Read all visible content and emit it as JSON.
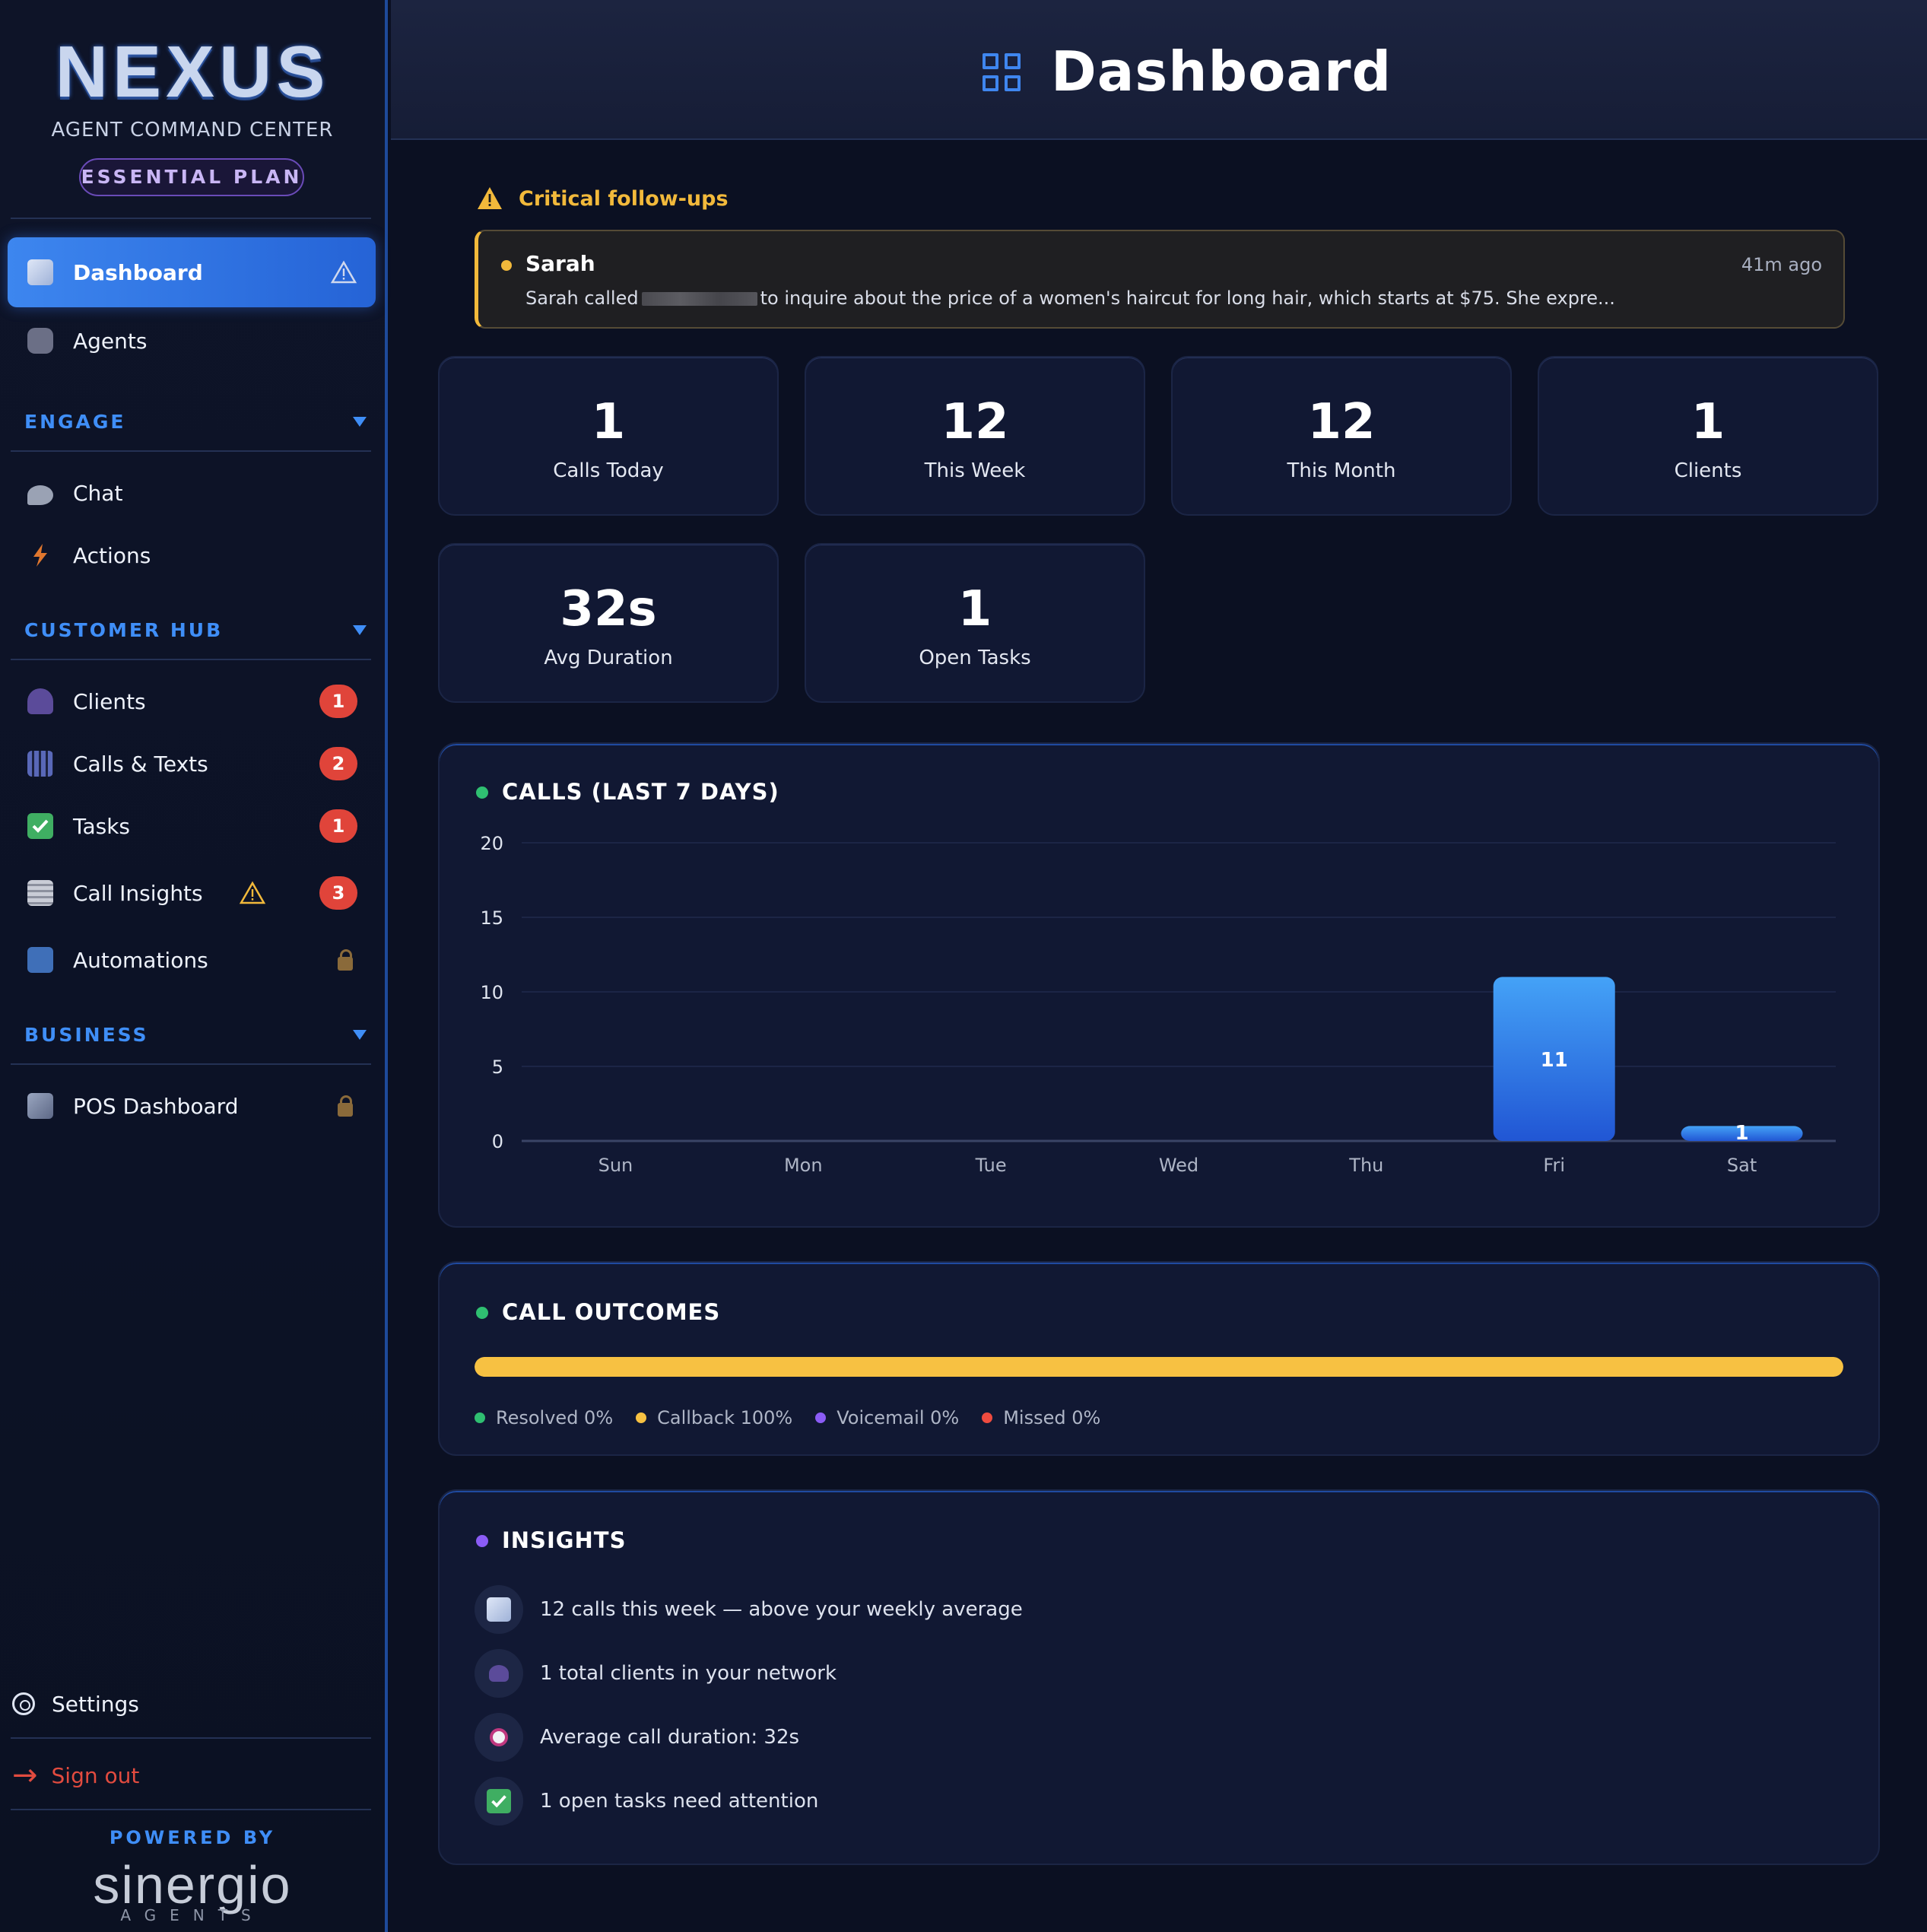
{
  "sidebar": {
    "logo": "NEXUS",
    "subtitle": "AGENT COMMAND CENTER",
    "plan": "ESSENTIAL PLAN",
    "nav_top": [
      {
        "label": "Dashboard",
        "icon": "chart-icon",
        "active": true,
        "warning": true
      },
      {
        "label": "Agents",
        "icon": "robot-icon"
      }
    ],
    "sections": {
      "engage": {
        "title": "ENGAGE",
        "items": [
          {
            "label": "Chat",
            "icon": "chat-bubble-icon"
          },
          {
            "label": "Actions",
            "icon": "lightning-icon"
          }
        ]
      },
      "customer_hub": {
        "title": "CUSTOMER HUB",
        "items": [
          {
            "label": "Clients",
            "icon": "users-icon",
            "badge": "1"
          },
          {
            "label": "Calls & Texts",
            "icon": "phone-grid-icon",
            "badge": "2"
          },
          {
            "label": "Tasks",
            "icon": "checkbox-icon",
            "badge": "1"
          },
          {
            "label": "Call Insights",
            "icon": "notepad-icon",
            "badge": "3",
            "warning": true
          },
          {
            "label": "Automations",
            "icon": "refresh-icon",
            "locked": true
          }
        ]
      },
      "business": {
        "title": "BUSINESS",
        "items": [
          {
            "label": "POS Dashboard",
            "icon": "chart-icon",
            "locked": true
          }
        ]
      }
    },
    "settings_label": "Settings",
    "signout_label": "Sign out",
    "powered_by": "POWERED BY",
    "brand": "sinergio",
    "brand_sub": "AGENTS"
  },
  "header": {
    "title": "Dashboard",
    "icon": "grid-icon"
  },
  "critical": {
    "title": "Critical follow-ups",
    "item": {
      "name": "Sarah",
      "time": "41m ago",
      "message_before": "Sarah called",
      "message_after": "to inquire about the price of a women's haircut for long hair, which starts at $75. She expre..."
    }
  },
  "stats": [
    {
      "value": "1",
      "label": "Calls Today"
    },
    {
      "value": "12",
      "label": "This Week"
    },
    {
      "value": "12",
      "label": "This Month"
    },
    {
      "value": "1",
      "label": "Clients"
    },
    {
      "value": "32s",
      "label": "Avg Duration"
    },
    {
      "value": "1",
      "label": "Open Tasks"
    }
  ],
  "chart_data": {
    "type": "bar",
    "title": "CALLS (LAST 7 DAYS)",
    "categories": [
      "Sun",
      "Mon",
      "Tue",
      "Wed",
      "Thu",
      "Fri",
      "Sat"
    ],
    "values": [
      0,
      0,
      0,
      0,
      0,
      11,
      1
    ],
    "ylim": [
      0,
      20
    ],
    "yticks": [
      0,
      5,
      10,
      15,
      20
    ],
    "grid": true,
    "bar_color": "#3b8ef3"
  },
  "outcomes": {
    "title": "CALL OUTCOMES",
    "items": [
      {
        "label": "Resolved 0%",
        "value": 0,
        "color": "#2fbf71"
      },
      {
        "label": "Callback 100%",
        "value": 100,
        "color": "#f7c142"
      },
      {
        "label": "Voicemail 0%",
        "value": 0,
        "color": "#8b5cf6"
      },
      {
        "label": "Missed 0%",
        "value": 0,
        "color": "#ef4b3f"
      }
    ]
  },
  "insights": {
    "title": "INSIGHTS",
    "items": [
      {
        "text": "12 calls this week — above your weekly average",
        "icon": "chart-icon"
      },
      {
        "text": "1 total clients in your network",
        "icon": "users-icon"
      },
      {
        "text": "Average call duration: 32s",
        "icon": "alarm-clock-icon"
      },
      {
        "text": "1 open tasks need attention",
        "icon": "checkbox-icon"
      }
    ]
  },
  "colors": {
    "accent": "#3f8ef7",
    "warning": "#f2b93b",
    "badge": "#e0443a",
    "signout": "#e24b3f"
  }
}
